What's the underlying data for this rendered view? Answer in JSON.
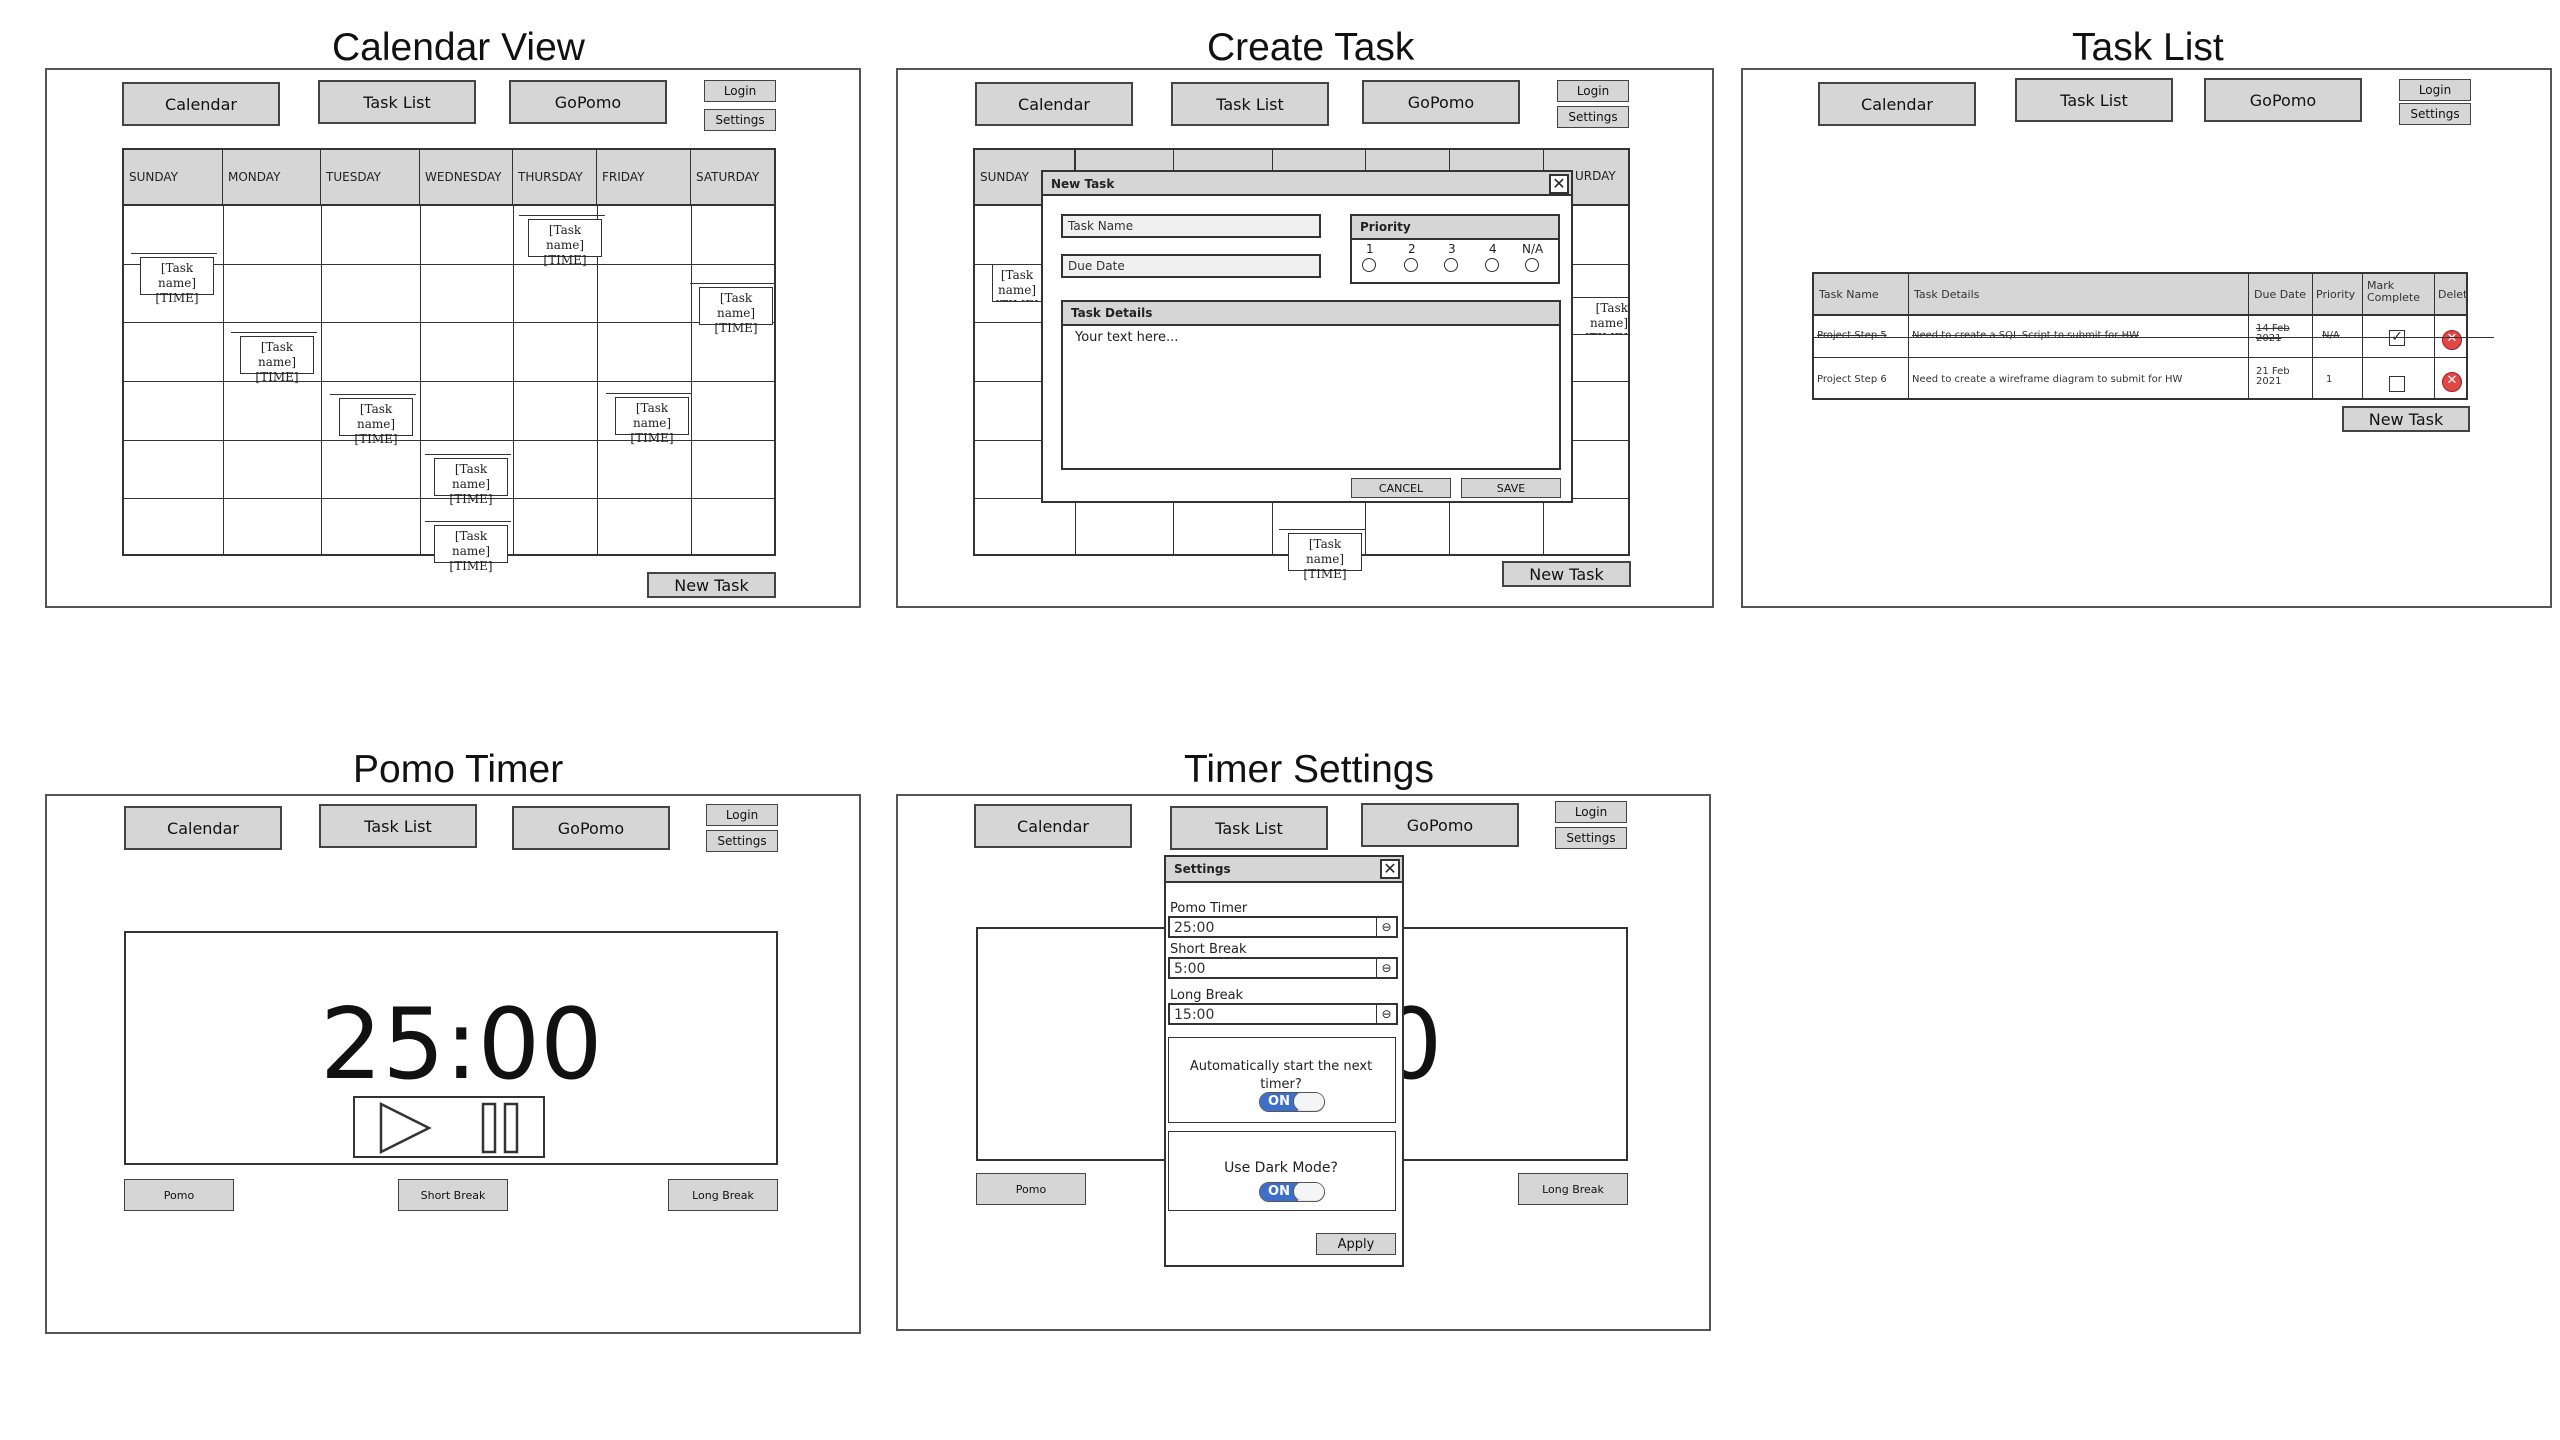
{
  "nav": {
    "calendar": "Calendar",
    "task_list": "Task List",
    "gopomo": "GoPomo",
    "login": "Login",
    "settings": "Settings"
  },
  "panels": {
    "calendar_view": {
      "title": "Calendar View"
    },
    "create_task": {
      "title": "Create Task"
    },
    "task_list": {
      "title": "Task List"
    },
    "pomo_timer": {
      "title": "Pomo Timer"
    },
    "timer_settings": {
      "title": "Timer Settings"
    }
  },
  "calendar": {
    "days": [
      "SUNDAY",
      "MONDAY",
      "TUESDAY",
      "WEDNESDAY",
      "THURSDAY",
      "FRIDAY",
      "SATURDAY"
    ],
    "task_chip_name": "[Task name]",
    "task_chip_time": "[TIME]",
    "new_task": "New Task"
  },
  "new_task_dialog": {
    "title": "New Task",
    "close": "✕",
    "task_name_placeholder": "Task Name",
    "due_date_placeholder": "Due Date",
    "priority_label": "Priority",
    "priority_options": [
      "1",
      "2",
      "3",
      "4",
      "N/A"
    ],
    "details_label": "Task Details",
    "details_placeholder": "Your text here...",
    "cancel": "CANCEL",
    "save": "SAVE"
  },
  "task_table": {
    "headers": [
      "Task Name",
      "Task Details",
      "Due Date",
      "Priority",
      "Mark Complete",
      "Delete"
    ],
    "rows": [
      {
        "name": "Project Step 5",
        "details": "Need to create a SQL Script to submit for HW",
        "due_line1": "14 Feb",
        "due_line2": "2021",
        "priority": "N/A",
        "complete": "✓",
        "delete": "✕"
      },
      {
        "name": "Project Step 6",
        "details": "Need to create a wireframe diagram to submit for HW",
        "due_line1": "21 Feb",
        "due_line2": "2021",
        "priority": "1",
        "complete": "",
        "delete": "✕"
      }
    ],
    "new_task": "New Task"
  },
  "pomo": {
    "time": "25:00",
    "pomo": "Pomo",
    "short_break": "Short Break",
    "long_break": "Long Break",
    "partial_time": "0"
  },
  "settings_dialog": {
    "title": "Settings",
    "close": "✕",
    "pomo_timer_label": "Pomo Timer",
    "pomo_timer_value": "25:00",
    "short_break_label": "Short Break",
    "short_break_value": "5:00",
    "long_break_label": "Long Break",
    "long_break_value": "15:00",
    "auto_start_label": "Automatically start the next timer?",
    "auto_start_toggle": "ON",
    "dark_mode_label": "Use Dark Mode?",
    "dark_mode_toggle": "ON",
    "apply": "Apply"
  },
  "colors": {
    "button_fill": "#d6d6d6",
    "toggle_on": "#3d6fc9",
    "delete_red": "#e04848"
  }
}
